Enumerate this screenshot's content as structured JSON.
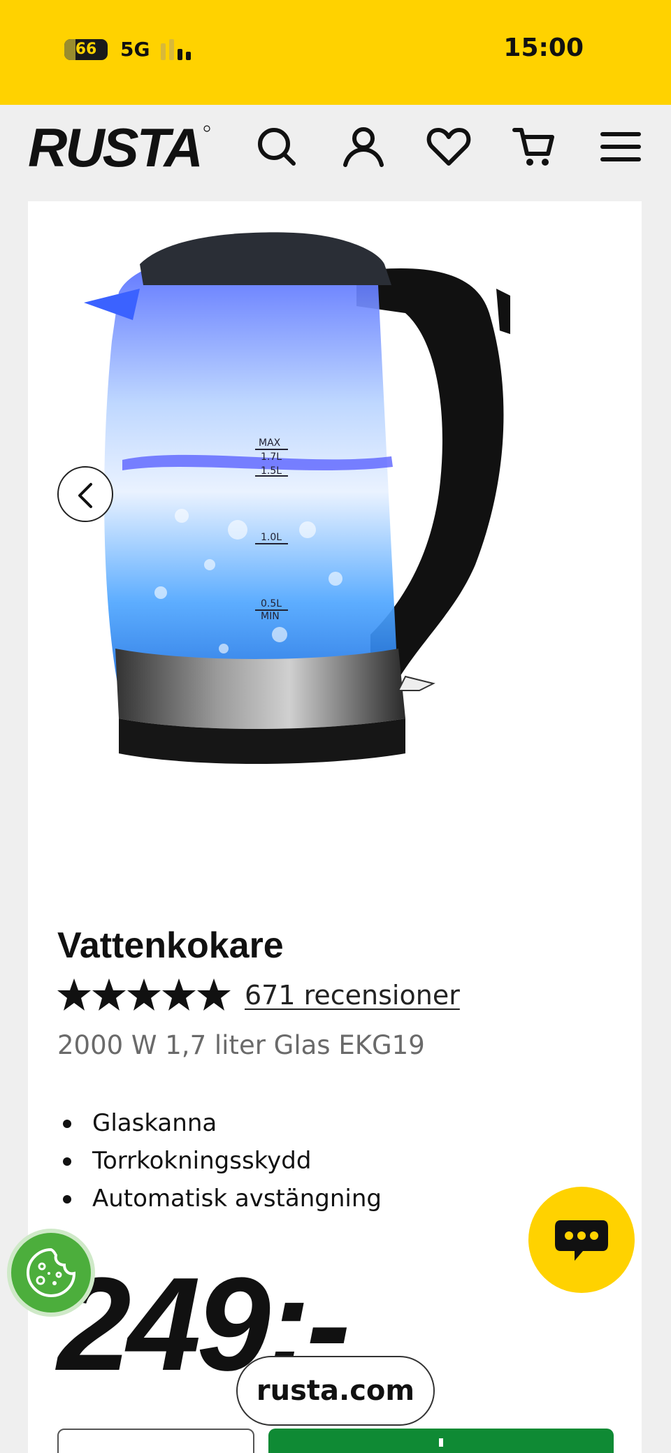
{
  "status_bar": {
    "battery": "66",
    "network": "5G",
    "time": "15:00"
  },
  "header": {
    "logo_text": "RUSTA",
    "icons": [
      "search-icon",
      "account-icon",
      "heart-icon",
      "cart-icon",
      "menu-icon"
    ],
    "background": "#ffd200"
  },
  "product": {
    "image_labels": [
      "MAX",
      "1.7L",
      "1.5L",
      "1.0L",
      "0.5L",
      "MIN"
    ],
    "title": "Vattenkokare",
    "rating": 5,
    "reviews": "671 recensioner",
    "subtitle": "2000 W 1,7 liter Glas EKG19",
    "features": [
      "Glaskanna",
      "Torrkokningsskydd",
      "Automatisk avstängning"
    ],
    "price": "249:-"
  },
  "browser": {
    "url": "rusta.com"
  },
  "colors": {
    "brand_yellow": "#ffd200",
    "buy_green": "#0f8a34",
    "cookie_green": "#4cae3c"
  }
}
